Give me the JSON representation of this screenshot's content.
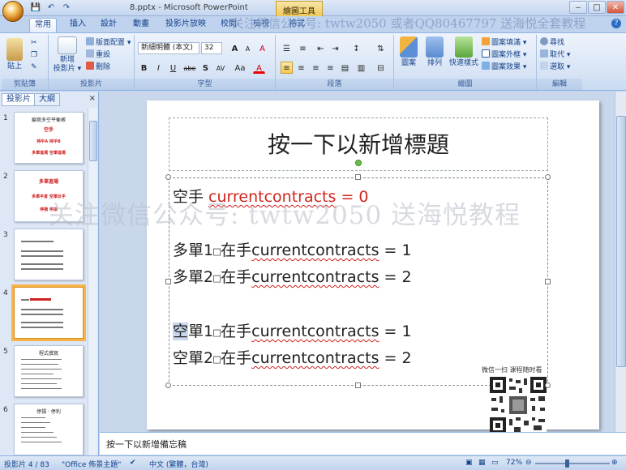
{
  "window": {
    "title": "8.pptx - Microsoft PowerPoint",
    "context_tool": "繪圖工具",
    "watermark_top": "关注微信公众号: twtw2050 或者QQ80467797 送海悦全套教程"
  },
  "qat": {
    "save": "💾",
    "undo": "↶",
    "redo": "↷"
  },
  "tabs": [
    "常用",
    "插入",
    "設計",
    "動畫",
    "投影片放映",
    "校閱",
    "檢視",
    "格式"
  ],
  "ribbon": {
    "clipboard": {
      "label": "剪貼簿",
      "paste": "貼上"
    },
    "slides": {
      "label": "投影片",
      "new_slide": "新增",
      "new_slide2": "投影片 ▾",
      "layout": "版面配置 ▾",
      "reset": "重設",
      "delete": "刪除"
    },
    "font": {
      "label": "字型",
      "font_name": "新細明體 (本文)",
      "font_size": "32",
      "bold": "B",
      "italic": "I",
      "underline": "U",
      "strike": "abe",
      "shadow": "S",
      "spacing": "AV",
      "case": "Aa",
      "color": "A",
      "grow": "A",
      "shrink": "A",
      "clear": "A"
    },
    "paragraph": {
      "label": "段落"
    },
    "drawing": {
      "label": "繪圖",
      "shapes": "圖案",
      "arrange": "排列",
      "quick_styles": "快速樣式",
      "fill": "圖案填滿 ▾",
      "outline": "圖案外框 ▾",
      "effects": "圖案效果 ▾"
    },
    "editing": {
      "label": "編輯",
      "find": "尋找",
      "replace": "取代 ▾",
      "select": "選取 ▾"
    }
  },
  "left_pane": {
    "tab_slides": "投影片",
    "tab_outline": "大綱",
    "close": "×",
    "thumbs": [
      {
        "num": "1",
        "title": "編寫多空平衡帳",
        "l1": "空手",
        "l2": "持平A    持平B",
        "l3": "多單進場  空單進場"
      },
      {
        "num": "2",
        "title": "",
        "l1": "多單進場",
        "l2": "多單平倉  空單反手",
        "l3": "停損  停損"
      },
      {
        "num": "3"
      },
      {
        "num": "4"
      },
      {
        "num": "5",
        "title": "程式撰寫"
      },
      {
        "num": "6",
        "title": "停損 · 停利"
      }
    ]
  },
  "slide": {
    "title_placeholder": "按一下以新增標題",
    "line1_pre": "空手 ",
    "line1_var": "currentcontracts",
    "line1_post": " = 0",
    "line2_pre": "多單1",
    "line2_sq": "□",
    "line2_mid": "在手",
    "line2_var": "currentcontracts",
    "line2_post": " = 1",
    "line3_pre": "多單2",
    "line3_sq": "□",
    "line3_mid": "在手",
    "line3_var": "currentcontracts",
    "line3_post": " = 2",
    "line4_k": "空",
    "line4_pre": "單1",
    "line4_sq": "□",
    "line4_mid": "在手",
    "line4_var": "currentcontracts",
    "line4_post": " = 1",
    "line5_pre": "空單2",
    "line5_sq": "□",
    "line5_mid": "在手",
    "line5_var": "currentcontracts",
    "line5_post": " = 2",
    "qr_caption": "微信一扫 课程随时看",
    "watermark": "关注微信公众号: twtw2050 送海悦教程"
  },
  "notes": {
    "placeholder": "按一下以新增備忘稿"
  },
  "status": {
    "slide_pos": "投影片 4 / 83",
    "theme": "\"Office 佈景主題\"",
    "language": "中文 (繁體，台灣)",
    "zoom": "72%"
  },
  "colors": {
    "accent": "#15428b",
    "ribbon_bg": "#d7e4f5",
    "selected_thumb": "#f6b54a",
    "red_text": "#d0251e"
  }
}
